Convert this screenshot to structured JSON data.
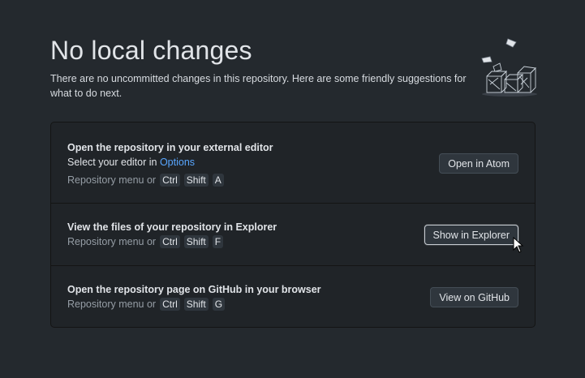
{
  "header": {
    "title": "No local changes",
    "subtitle": "There are no uncommitted changes in this repository. Here are some friendly suggestions for what to do next."
  },
  "actions": [
    {
      "title": "Open the repository in your external editor",
      "sub_prefix": "Select your editor in ",
      "sub_link": "Options",
      "shortcut_prefix": "Repository menu or",
      "keys": [
        "Ctrl",
        "Shift",
        "A"
      ],
      "button_label": "Open in Atom",
      "icon": "none"
    },
    {
      "title": "View the files of your repository in Explorer",
      "shortcut_prefix": "Repository menu or",
      "keys": [
        "Ctrl",
        "Shift",
        "F"
      ],
      "button_label": "Show in Explorer"
    },
    {
      "title": "Open the repository page on GitHub in your browser",
      "shortcut_prefix": "Repository menu or",
      "keys": [
        "Ctrl",
        "Shift",
        "G"
      ],
      "button_label": "View on GitHub"
    }
  ],
  "colors": {
    "background": "#24292e",
    "card": "#202428",
    "link": "#58a6ff",
    "button": "#2f363d"
  },
  "icons": {
    "illustration": "empty-boxes-illustration",
    "cursor": "mouse-pointer-icon"
  }
}
